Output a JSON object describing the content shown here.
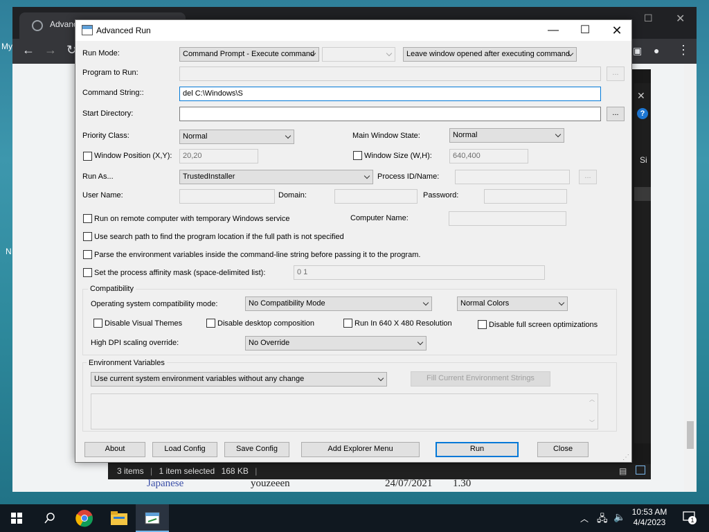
{
  "desktop": {
    "label_my": "My",
    "label_n": "N"
  },
  "chrome": {
    "tab_title": "Advance"
  },
  "explorer": {
    "status_items": "3 items",
    "status_selected": "1 item selected",
    "status_size": "168 KB",
    "side_label": "Si"
  },
  "behind_row": {
    "name": "Japanese",
    "user": "youzeeen",
    "date": "24/07/2021",
    "num": "1.30"
  },
  "dialog": {
    "title": "Advanced Run",
    "run_mode_label": "Run Mode:",
    "run_mode_value": "Command Prompt - Execute command",
    "run_mode_extra": "",
    "after_exec_value": "Leave window opened after executing command",
    "program_label": "Program to Run:",
    "program_value": "",
    "command_label": "Command String::",
    "command_value": "del C:\\Windows\\S",
    "start_dir_label": "Start Directory:",
    "start_dir_value": "",
    "browse_label": "...",
    "priority_label": "Priority Class:",
    "priority_value": "Normal",
    "main_state_label": "Main Window State:",
    "main_state_value": "Normal",
    "win_pos_label": "Window Position (X,Y):",
    "win_pos_value": "20,20",
    "win_size_label": "Window Size (W,H):",
    "win_size_value": "640,400",
    "run_as_label": "Run As...",
    "run_as_value": "TrustedInstaller",
    "process_label": "Process ID/Name:",
    "username_label": "User Name:",
    "domain_label": "Domain:",
    "password_label": "Password:",
    "remote_label": "Run on remote computer with temporary Windows service",
    "computer_label": "Computer Name:",
    "search_path_label": "Use search path to find the program location if the full path is not specified",
    "parse_env_label": "Parse the environment variables inside the command-line string before passing it to the program.",
    "affinity_label": "Set the process affinity mask (space-delimited list):",
    "affinity_value": "0 1",
    "compat_group": "Compatibility",
    "os_compat_label": "Operating system compatibility mode:",
    "os_compat_value": "No Compatibility Mode",
    "colors_value": "Normal Colors",
    "disable_themes": "Disable Visual Themes",
    "disable_desktop": "Disable desktop composition",
    "run_640": "Run In 640 X 480 Resolution",
    "disable_fullscreen": "Disable full screen optimizations",
    "dpi_label": "High DPI scaling override:",
    "dpi_value": "No Override",
    "env_group": "Environment Variables",
    "env_value": "Use current system environment variables without any change",
    "fill_env_button": "Fill Current Environment Strings",
    "buttons": {
      "about": "About",
      "load": "Load Config",
      "save": "Save Config",
      "explorer_menu": "Add Explorer Menu",
      "run": "Run",
      "close": "Close"
    }
  },
  "taskbar": {
    "time": "10:53 AM",
    "date": "4/4/2023",
    "notifications": "1"
  }
}
